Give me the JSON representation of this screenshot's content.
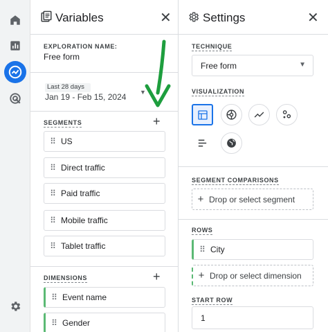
{
  "variables": {
    "title": "Variables",
    "exploration_label": "EXPLORATION NAME:",
    "exploration_name": "Free form",
    "date_range_label": "Last 28 days",
    "date_range": "Jan 19 - Feb 15, 2024",
    "segments_label": "SEGMENTS",
    "segments": [
      "US",
      "Direct traffic",
      "Paid traffic",
      "Mobile traffic",
      "Tablet traffic"
    ],
    "dimensions_label": "DIMENSIONS",
    "dimensions": [
      "Event name",
      "Gender"
    ]
  },
  "settings": {
    "title": "Settings",
    "technique_label": "TECHNIQUE",
    "technique_value": "Free form",
    "visualization_label": "VISUALIZATION",
    "segment_comparisons_label": "SEGMENT COMPARISONS",
    "segment_dropzone": "Drop or select segment",
    "rows_label": "ROWS",
    "rows": [
      "City"
    ],
    "dimension_dropzone": "Drop or select dimension",
    "start_row_label": "START ROW",
    "start_row_value": "1"
  },
  "rail_icons": [
    "home-icon",
    "reports-icon",
    "explore-icon",
    "advertising-icon",
    "settings-gear-icon"
  ],
  "colors": {
    "accent": "#1a73e8",
    "green_marker": "#5bb974",
    "arrow_green": "#1e9e3e"
  }
}
